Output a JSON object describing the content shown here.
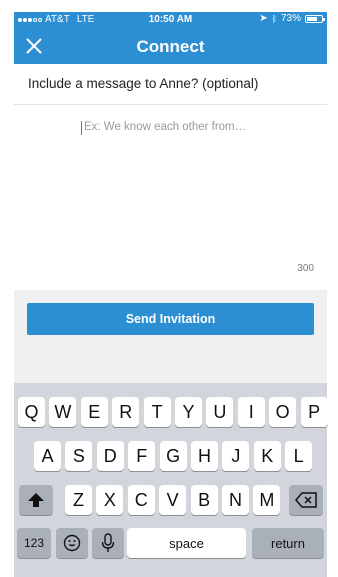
{
  "status": {
    "carrier": "AT&T",
    "network": "LTE",
    "time": "10:50 AM",
    "battery": "73%",
    "battery_level": 0.73
  },
  "nav": {
    "title": "Connect",
    "close_icon": "close-icon"
  },
  "prompt": "Include a message to Anne? (optional)",
  "message": {
    "placeholder": "Ex: We know each other from…",
    "char_count": "300"
  },
  "send_button": "Send Invitation",
  "keyboard": {
    "row1": [
      "Q",
      "W",
      "E",
      "R",
      "T",
      "Y",
      "U",
      "I",
      "O",
      "P"
    ],
    "row2": [
      "A",
      "S",
      "D",
      "F",
      "G",
      "H",
      "J",
      "K",
      "L"
    ],
    "row3": [
      "Z",
      "X",
      "C",
      "V",
      "B",
      "N",
      "M"
    ],
    "numbers_key": "123",
    "space_key": "space",
    "return_key": "return",
    "icons": [
      "shift-icon",
      "backspace-icon",
      "emoji-icon",
      "microphone-icon"
    ]
  },
  "colors": {
    "accent": "#2d8fd3",
    "keyboard_bg": "#d2d5db"
  }
}
